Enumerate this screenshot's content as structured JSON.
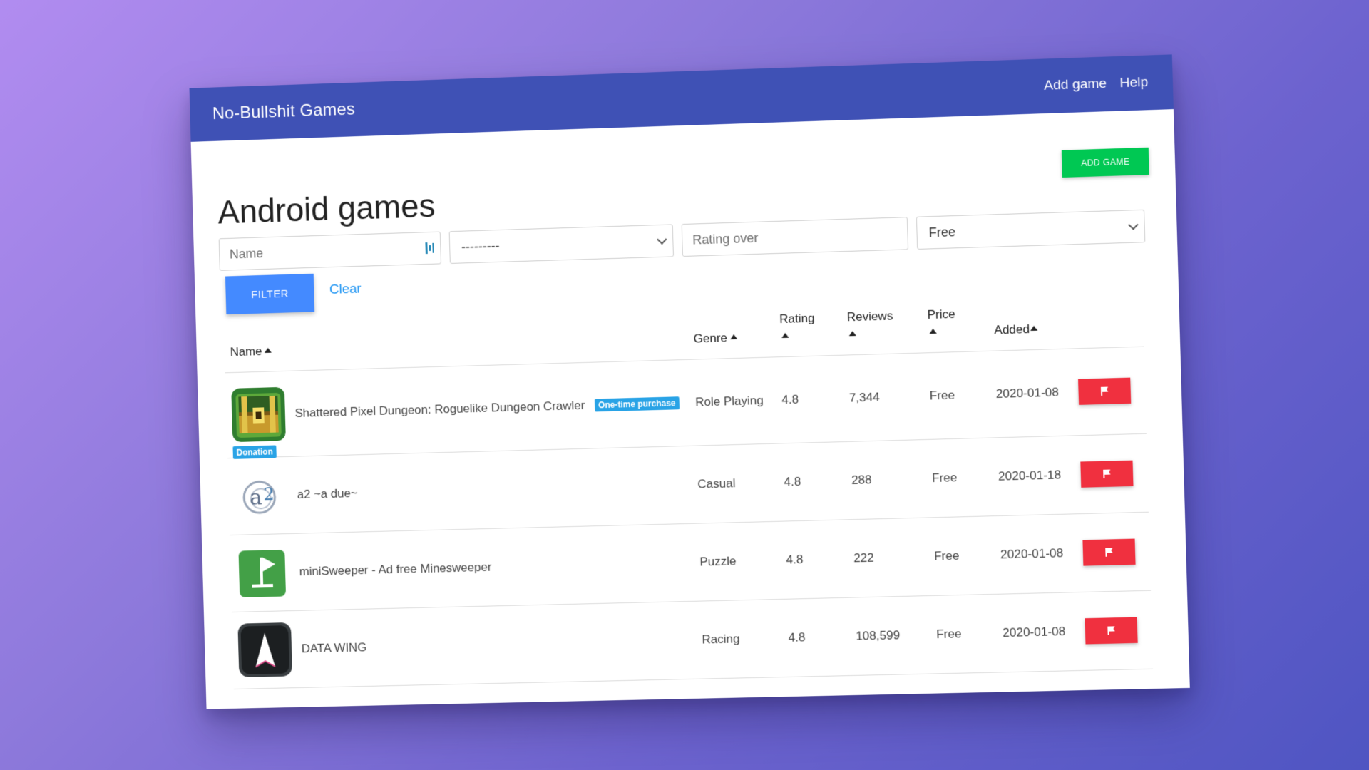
{
  "navbar": {
    "brand": "No-Bullshit Games",
    "links": [
      "Add game",
      "Help"
    ]
  },
  "page": {
    "title": "Android games",
    "add_game_label": "ADD GAME"
  },
  "filters": {
    "name_placeholder": "Name",
    "genre_value": "---------",
    "rating_placeholder": "Rating over",
    "price_value": "Free",
    "filter_label": "FILTER",
    "clear_label": "Clear"
  },
  "table": {
    "headers": [
      "Name",
      "Genre",
      "Rating",
      "Reviews",
      "Price",
      "Added"
    ],
    "rows": [
      {
        "name": "Shattered Pixel Dungeon: Roguelike Dungeon Crawler",
        "badge": "One-time purchase",
        "icon_badge": "Donation",
        "icon": "pixel-dungeon-chest-icon",
        "genre": "Role Playing",
        "rating": "4.8",
        "reviews": "7,344",
        "price": "Free",
        "added": "2020-01-08"
      },
      {
        "name": "a2 ~a due~",
        "icon": "a2-logo-icon",
        "genre": "Casual",
        "rating": "4.8",
        "reviews": "288",
        "price": "Free",
        "added": "2020-01-18"
      },
      {
        "name": "miniSweeper - Ad free Minesweeper",
        "icon": "minesweeper-flag-icon",
        "genre": "Puzzle",
        "rating": "4.8",
        "reviews": "222",
        "price": "Free",
        "added": "2020-01-08"
      },
      {
        "name": "DATA WING",
        "icon": "data-wing-arrow-icon",
        "genre": "Racing",
        "rating": "4.8",
        "reviews": "108,599",
        "price": "Free",
        "added": "2020-01-08"
      }
    ]
  },
  "colors": {
    "navbar": "#3f51b5",
    "add_game_button": "#00c853",
    "filter_button": "#448aff",
    "report_button": "#f0303f",
    "badge": "#29a3e6"
  }
}
